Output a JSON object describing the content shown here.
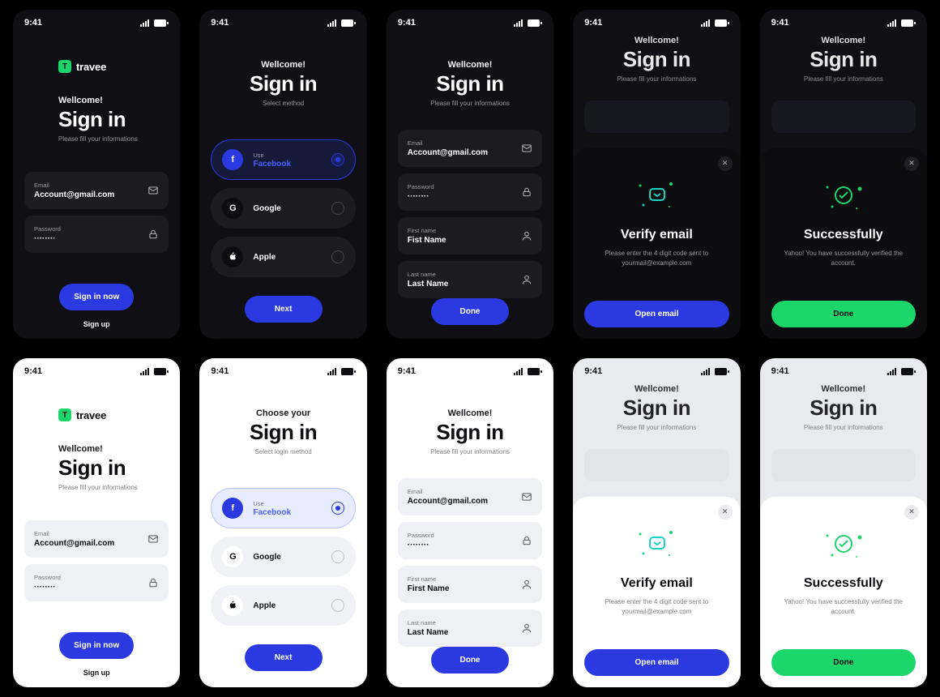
{
  "status": {
    "time": "9:41"
  },
  "brand": {
    "initial": "T",
    "name": "travee"
  },
  "common": {
    "greet": "Wellcome!",
    "title": "Sign in",
    "sub": "Please fill your informations"
  },
  "alt": {
    "greet": "Choose your",
    "title": "Sign in",
    "sub": "Select login method",
    "sub_short": "Select method"
  },
  "fields": {
    "email_label": "Email",
    "email_value": "Account@gmail.com",
    "password_label": "Password",
    "password_value": "········",
    "firstname_label": "First name",
    "firstname_value_dark": "Fist Name",
    "firstname_value_light": "First Name",
    "lastname_label": "Last name",
    "lastname_value": "Last Name"
  },
  "providers": {
    "use_label": "Use",
    "facebook": "Facebook",
    "google": "Google",
    "apple": "Apple"
  },
  "buttons": {
    "signin": "Sign in now",
    "signup": "Sign up",
    "next": "Next",
    "done": "Done",
    "open_email": "Open email"
  },
  "modal_verify": {
    "title": "Verify email",
    "sub": "Please enter the 4 digit code sent to yourmail@example.com"
  },
  "modal_success": {
    "title": "Successfully",
    "sub": "Yahoo! You have successfully verified the account."
  }
}
